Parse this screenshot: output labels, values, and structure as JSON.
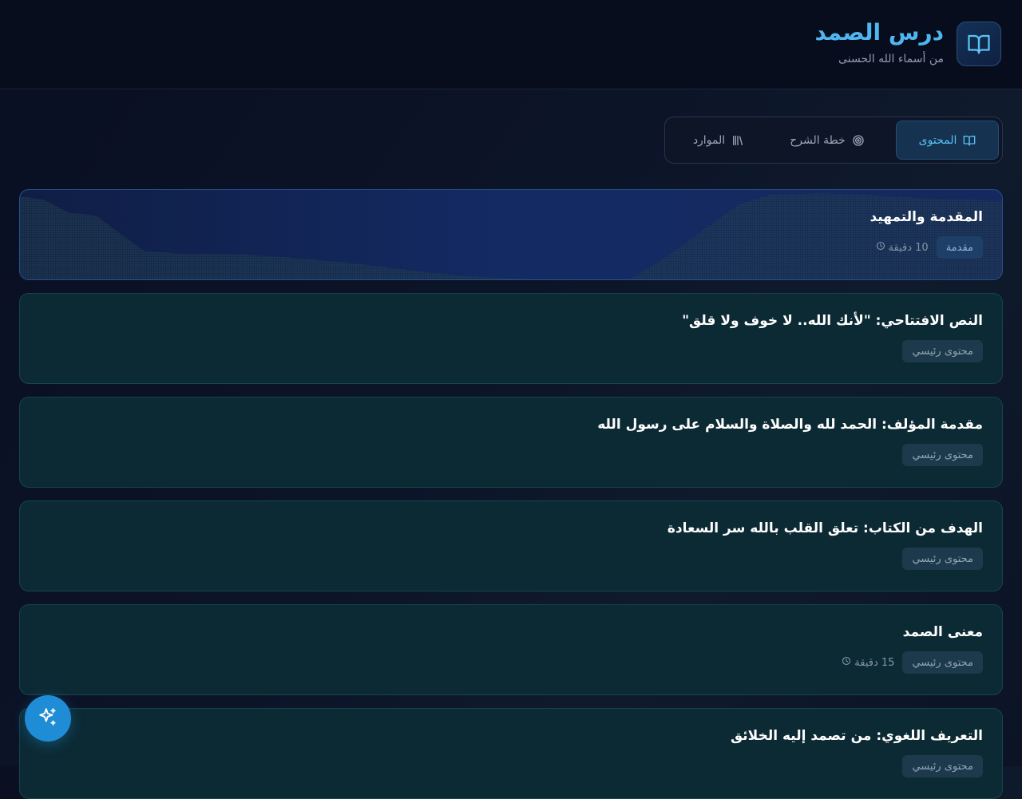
{
  "header": {
    "title": "درس الصمد",
    "subtitle": "من أسماء الله الحسنى",
    "logo_icon": "book-open-icon"
  },
  "tabs": [
    {
      "label": "المحتوى",
      "icon": "book-open-icon",
      "active": true
    },
    {
      "label": "خطة الشرح",
      "icon": "target-icon",
      "active": false
    },
    {
      "label": "الموارد",
      "icon": "library-icon",
      "active": false
    }
  ],
  "cards": [
    {
      "title": "المقدمة والتمهيد",
      "badge": "مقدمة",
      "duration": "10 دقيقة"
    },
    {
      "title": "النص الافتتاحي: \"لأنك الله.. لا خوف ولا قلق\"",
      "badge": "محتوى رئيسي",
      "duration": null
    },
    {
      "title": "مقدمة المؤلف: الحمد لله والصلاة والسلام على رسول الله",
      "badge": "محتوى رئيسي",
      "duration": null
    },
    {
      "title": "الهدف من الكتاب: تعلق القلب بالله سر السعادة",
      "badge": "محتوى رئيسي",
      "duration": null
    },
    {
      "title": "معنى الصمد",
      "badge": "محتوى رئيسي",
      "duration": "15 دقيقة"
    },
    {
      "title": "التعريف اللغوي: من تصمد إليه الخلائق",
      "badge": "محتوى رئيسي",
      "duration": null
    }
  ],
  "fab": {
    "icon": "sparkles-icon"
  },
  "colors": {
    "accent": "#4fb6f0",
    "fab": "#1f8cd6",
    "card_teal": "#0c2a34",
    "card_intro": "#142a63"
  }
}
